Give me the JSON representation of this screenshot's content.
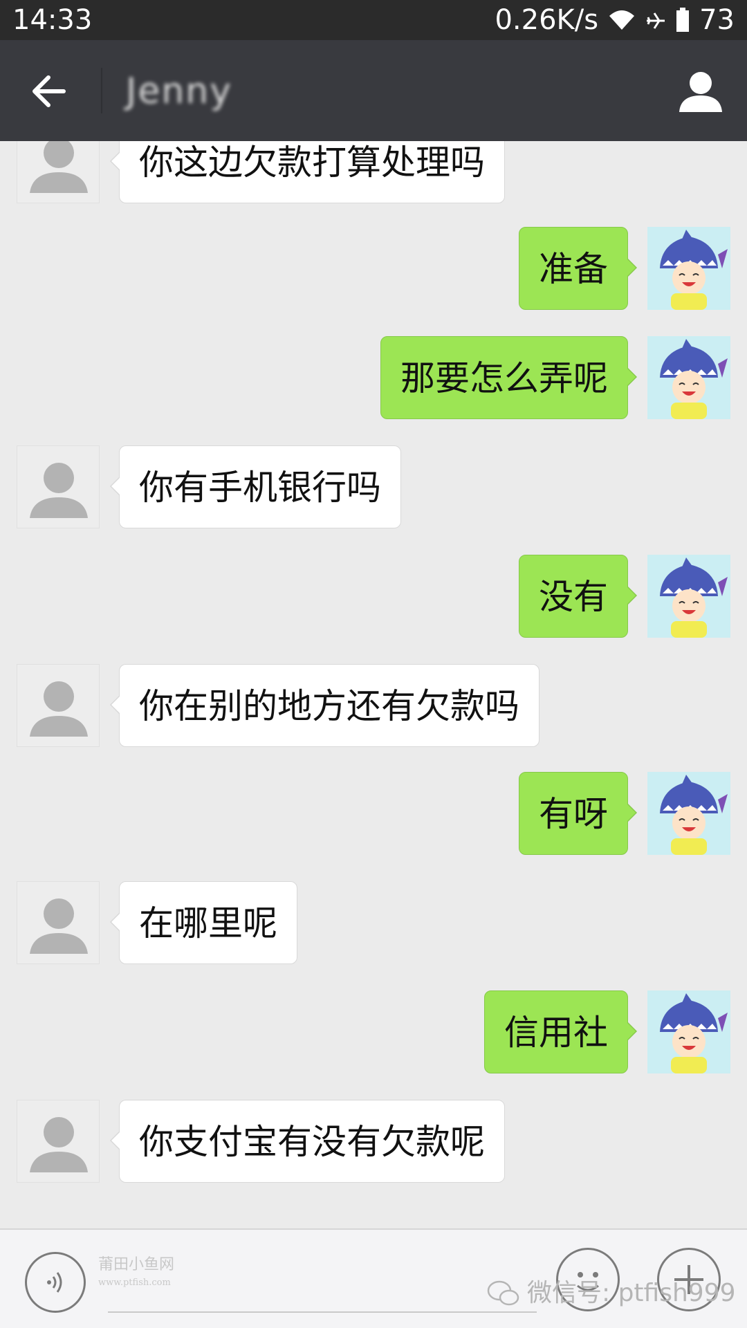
{
  "status_bar": {
    "time": "14:33",
    "network_speed": "0.26K/s",
    "battery": "73",
    "icons": [
      "wifi-icon",
      "airplane-icon",
      "battery-icon"
    ]
  },
  "header": {
    "contact_name": "Jenny",
    "back_icon": "arrow-left-icon",
    "profile_icon": "person-icon"
  },
  "messages": [
    {
      "from": "contact",
      "text": "你这边欠款打算处理吗"
    },
    {
      "from": "me",
      "text": "准备"
    },
    {
      "from": "me",
      "text": "那要怎么弄呢"
    },
    {
      "from": "contact",
      "text": "你有手机银行吗"
    },
    {
      "from": "me",
      "text": "没有"
    },
    {
      "from": "contact",
      "text": "你在别的地方还有欠款吗"
    },
    {
      "from": "me",
      "text": "有呀"
    },
    {
      "from": "contact",
      "text": "在哪里呢"
    },
    {
      "from": "me",
      "text": "信用社"
    },
    {
      "from": "contact",
      "text": "你支付宝有没有欠款呢"
    }
  ],
  "input_bar": {
    "voice_icon": "voice-icon",
    "emoji_icon": "emoji-icon",
    "plus_icon": "plus-icon"
  },
  "watermarks": {
    "left": "莆田小鱼网",
    "left_sub": "www.ptfish.com",
    "right": "微信号: ptfish999"
  },
  "colors": {
    "nav_bg": "#393a3f",
    "out_bubble": "#9ce554",
    "in_bubble": "#ffffff",
    "chat_bg": "#ebebeb"
  }
}
